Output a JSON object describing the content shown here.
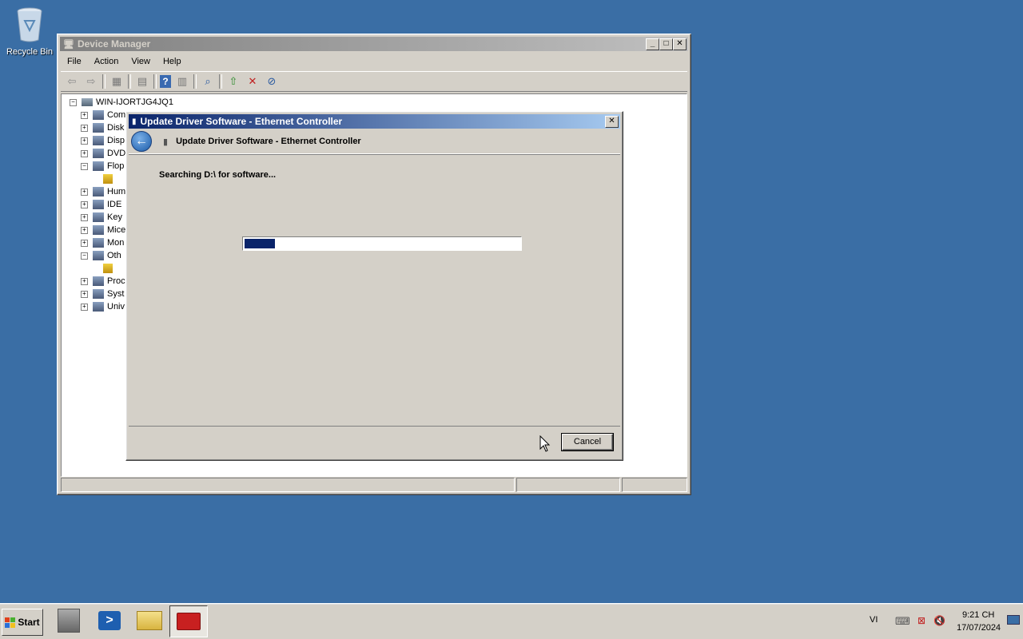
{
  "desktop": {
    "recycle_bin_label": "Recycle Bin"
  },
  "device_manager": {
    "title": "Device Manager",
    "menu": [
      "File",
      "Action",
      "View",
      "Help"
    ],
    "tree": {
      "root": "WIN-IJORTJG4JQ1",
      "items": [
        {
          "label": "Com",
          "expander": "+"
        },
        {
          "label": "Disk",
          "expander": "+"
        },
        {
          "label": "Disp",
          "expander": "+"
        },
        {
          "label": "DVD",
          "expander": "+"
        },
        {
          "label": "Flop",
          "expander": "−"
        },
        {
          "label": "",
          "expander": ""
        },
        {
          "label": "Hum",
          "expander": "+"
        },
        {
          "label": "IDE",
          "expander": "+"
        },
        {
          "label": "Key",
          "expander": "+"
        },
        {
          "label": "Mice",
          "expander": "+"
        },
        {
          "label": "Mon",
          "expander": "+"
        },
        {
          "label": "Oth",
          "expander": "−"
        },
        {
          "label": "",
          "expander": ""
        },
        {
          "label": "Proc",
          "expander": "+"
        },
        {
          "label": "Syst",
          "expander": "+"
        },
        {
          "label": "Univ",
          "expander": "+"
        }
      ]
    }
  },
  "dialog": {
    "title": "Update Driver Software - Ethernet Controller",
    "heading": "Update Driver Software - Ethernet Controller",
    "status": "Searching D:\\ for software...",
    "progress_fraction": 0.11,
    "cancel_label": "Cancel"
  },
  "taskbar": {
    "start_label": "Start",
    "language": "VI",
    "time": "9:21 CH",
    "date": "17/07/2024"
  },
  "colors": {
    "desktop": "#3a6ea5",
    "progress_fill": "#0a246a",
    "active_title": "#0a246a"
  }
}
